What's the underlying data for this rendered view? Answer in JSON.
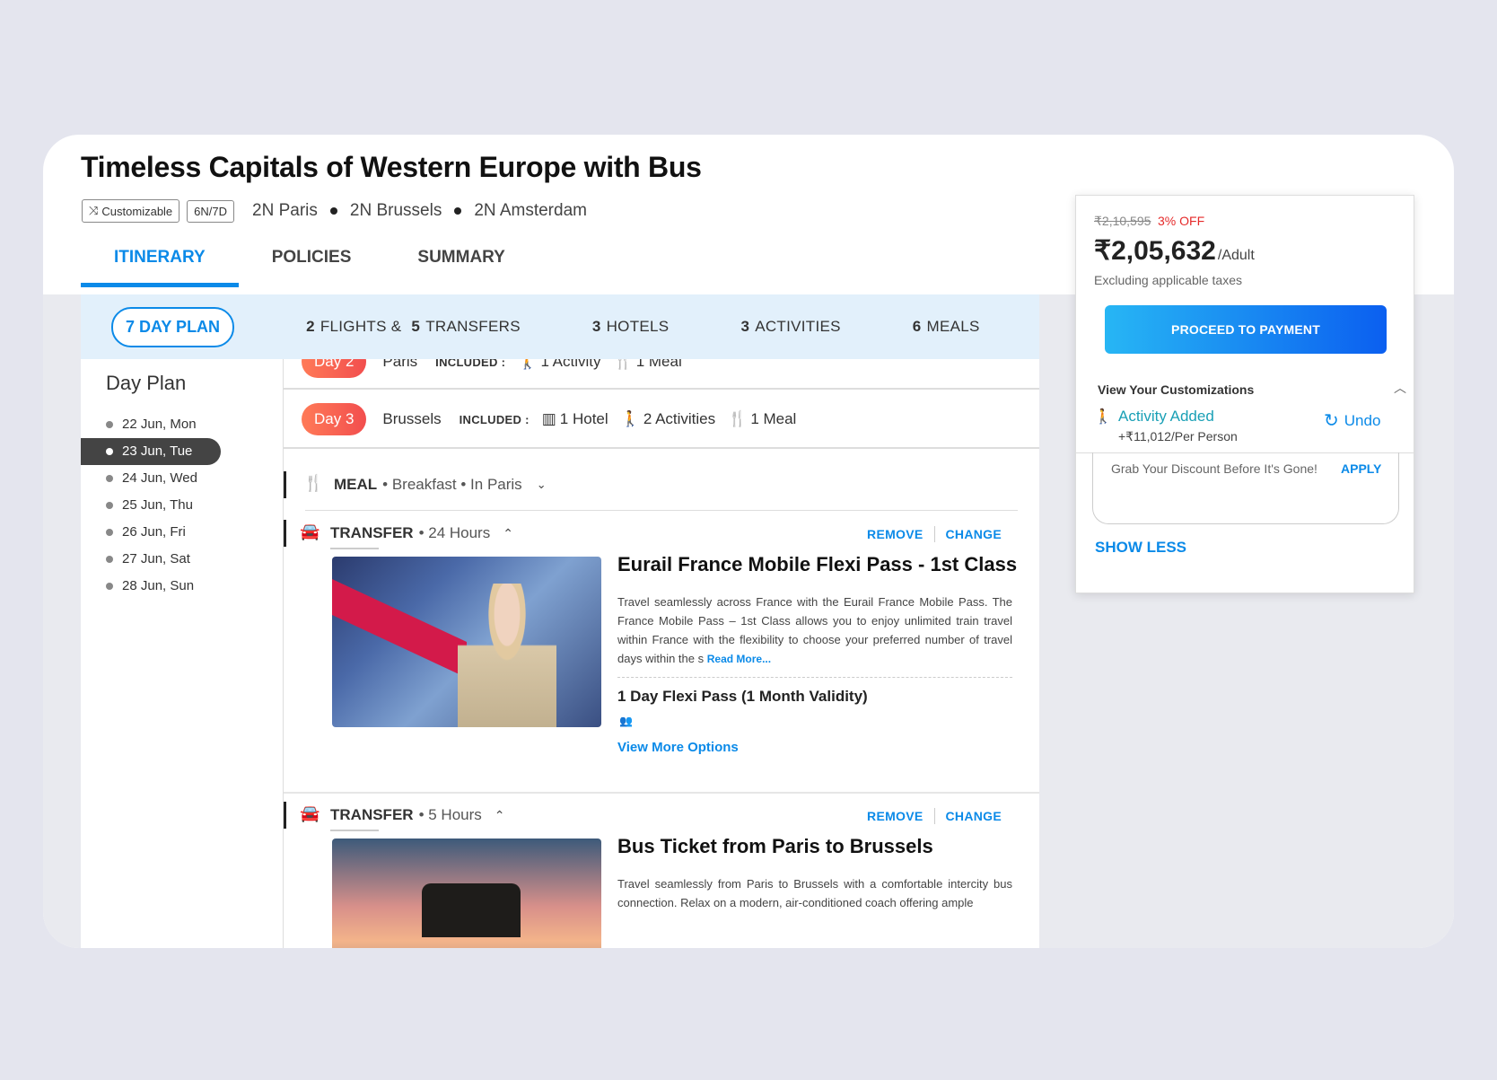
{
  "package": {
    "title": "Timeless Capitals of Western Europe with Bus",
    "customizable_label": "Customizable",
    "duration_label": "6N/7D",
    "cities": [
      "2N Paris",
      "2N Brussels",
      "2N Amsterdam"
    ]
  },
  "tabs": [
    {
      "label": "ITINERARY",
      "active": true
    },
    {
      "label": "POLICIES",
      "active": false
    },
    {
      "label": "SUMMARY",
      "active": false
    }
  ],
  "subnav": {
    "day_plan": {
      "count": "7",
      "label": "DAY PLAN"
    },
    "items": [
      {
        "count": "2",
        "label": "FLIGHTS &",
        "count2": "5",
        "label2": "TRANSFERS"
      },
      {
        "count": "3",
        "label": "HOTELS"
      },
      {
        "count": "3",
        "label": "ACTIVITIES"
      },
      {
        "count": "6",
        "label": "MEALS"
      }
    ]
  },
  "sidebar": {
    "title": "Day Plan",
    "dates": [
      "22 Jun, Mon",
      "23 Jun, Tue",
      "24 Jun, Wed",
      "25 Jun, Thu",
      "26 Jun, Fri",
      "27 Jun, Sat",
      "28 Jun, Sun"
    ],
    "active_index": 1
  },
  "days": [
    {
      "badge": "Day 2",
      "city": "Paris",
      "included_label": "INCLUDED :",
      "items": [
        "1 Activity",
        "1 Meal"
      ]
    },
    {
      "badge": "Day 3",
      "city": "Brussels",
      "included_label": "INCLUDED :",
      "items": [
        "1 Hotel",
        "2 Activities",
        "1 Meal"
      ]
    }
  ],
  "meal": {
    "label": "MEAL",
    "detail": "• Breakfast • In Paris"
  },
  "transfers": [
    {
      "label": "TRANSFER",
      "duration": "• 24 Hours",
      "remove": "REMOVE",
      "change": "CHANGE",
      "title": "Eurail France Mobile Flexi Pass - 1st Class",
      "description": "Travel seamlessly across France with the Eurail France Mobile Pass. The France Mobile Pass – 1st Class allows you to enjoy unlimited train travel within France with the flexibility to choose your preferred number of travel days within the s",
      "read_more": "Read More...",
      "option": "1 Day Flexi Pass (1 Month Validity)",
      "view_more": "View More Options"
    },
    {
      "label": "TRANSFER",
      "duration": "• 5 Hours",
      "remove": "REMOVE",
      "change": "CHANGE",
      "title": "Bus Ticket from Paris to Brussels",
      "description": "Travel seamlessly from Paris to Brussels with a comfortable intercity bus connection. Relax on a modern, air-conditioned coach offering ample"
    }
  ],
  "pricing": {
    "old_price": "₹2,10,595",
    "discount": "3% OFF",
    "price": "₹2,05,632",
    "per": "/Adult",
    "tax_note": "Excluding applicable taxes",
    "cta": "PROCEED TO PAYMENT",
    "customizations_label": "View Your Customizations",
    "activity_added": "Activity Added",
    "activity_amount": "+₹11,012/Per Person",
    "undo": "Undo",
    "discount_prompt": "Grab Your Discount Before It's Gone!",
    "apply": "APPLY",
    "show_less": "SHOW LESS"
  },
  "colors": {
    "accent": "#0b8ae8",
    "day_badge": "#f24e4e",
    "activity_added": "#1aa0b6",
    "discount": "#e52a2a"
  }
}
